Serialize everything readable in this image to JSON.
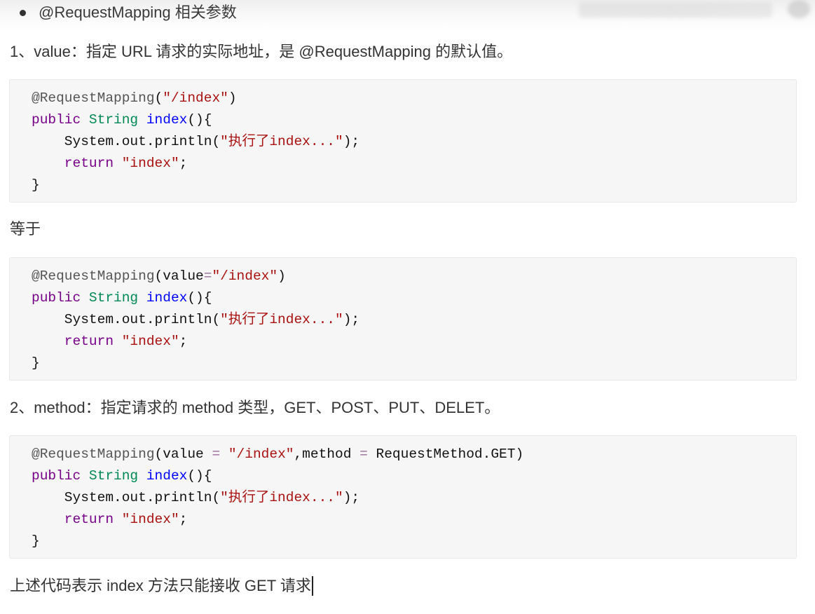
{
  "outline": {
    "bullet_text": "@RequestMapping 相关参数"
  },
  "paragraphs": {
    "value_desc": "1、value：指定 URL 请求的实际地址，是 @RequestMapping 的默认值。",
    "equals": "等于",
    "method_desc": "2、method：指定请求的 method 类型，GET、POST、PUT、DELET。",
    "summary": "上述代码表示 index 方法只能接收 GET 请求"
  },
  "code_colors": {
    "plain": "#111111",
    "meta": "#555555",
    "string": "#aa1111",
    "keyword": "#770088",
    "type": "#008855",
    "def": "#0000ff",
    "operator": "#9a6e9a",
    "block_background": "#f6f6f6"
  },
  "code_blocks": [
    {
      "lines": [
        [
          {
            "text": "@RequestMapping",
            "kind": "meta"
          },
          {
            "text": "(",
            "kind": "plain"
          },
          {
            "text": "\"/index\"",
            "kind": "string"
          },
          {
            "text": ")",
            "kind": "plain"
          }
        ],
        [
          {
            "text": "public ",
            "kind": "keyword"
          },
          {
            "text": "String ",
            "kind": "type"
          },
          {
            "text": "index",
            "kind": "def"
          },
          {
            "text": "(){",
            "kind": "plain"
          }
        ],
        [
          {
            "text": "    System.out.println(",
            "kind": "plain"
          },
          {
            "text": "\"执行了index...\"",
            "kind": "string"
          },
          {
            "text": ");",
            "kind": "plain"
          }
        ],
        [
          {
            "text": "    return ",
            "kind": "keyword"
          },
          {
            "text": "\"index\"",
            "kind": "string"
          },
          {
            "text": ";",
            "kind": "plain"
          }
        ],
        [
          {
            "text": "}",
            "kind": "plain"
          }
        ]
      ]
    },
    {
      "lines": [
        [
          {
            "text": "@RequestMapping",
            "kind": "meta"
          },
          {
            "text": "(value",
            "kind": "plain"
          },
          {
            "text": "=",
            "kind": "operator"
          },
          {
            "text": "\"/index\"",
            "kind": "string"
          },
          {
            "text": ")",
            "kind": "plain"
          }
        ],
        [
          {
            "text": "public ",
            "kind": "keyword"
          },
          {
            "text": "String ",
            "kind": "type"
          },
          {
            "text": "index",
            "kind": "def"
          },
          {
            "text": "(){",
            "kind": "plain"
          }
        ],
        [
          {
            "text": "    System.out.println(",
            "kind": "plain"
          },
          {
            "text": "\"执行了index...\"",
            "kind": "string"
          },
          {
            "text": ");",
            "kind": "plain"
          }
        ],
        [
          {
            "text": "    return ",
            "kind": "keyword"
          },
          {
            "text": "\"index\"",
            "kind": "string"
          },
          {
            "text": ";",
            "kind": "plain"
          }
        ],
        [
          {
            "text": "}",
            "kind": "plain"
          }
        ]
      ]
    },
    {
      "lines": [
        [
          {
            "text": "@RequestMapping",
            "kind": "meta"
          },
          {
            "text": "(value ",
            "kind": "plain"
          },
          {
            "text": "=",
            "kind": "operator"
          },
          {
            "text": " \"/index\"",
            "kind": "string"
          },
          {
            "text": ",method ",
            "kind": "plain"
          },
          {
            "text": "=",
            "kind": "operator"
          },
          {
            "text": " RequestMethod.GET)",
            "kind": "plain"
          }
        ],
        [
          {
            "text": "public ",
            "kind": "keyword"
          },
          {
            "text": "String ",
            "kind": "type"
          },
          {
            "text": "index",
            "kind": "def"
          },
          {
            "text": "(){",
            "kind": "plain"
          }
        ],
        [
          {
            "text": "    System.out.println(",
            "kind": "plain"
          },
          {
            "text": "\"执行了index...\"",
            "kind": "string"
          },
          {
            "text": ");",
            "kind": "plain"
          }
        ],
        [
          {
            "text": "    return ",
            "kind": "keyword"
          },
          {
            "text": "\"index\"",
            "kind": "string"
          },
          {
            "text": ";",
            "kind": "plain"
          }
        ],
        [
          {
            "text": "}",
            "kind": "plain"
          }
        ]
      ]
    }
  ]
}
